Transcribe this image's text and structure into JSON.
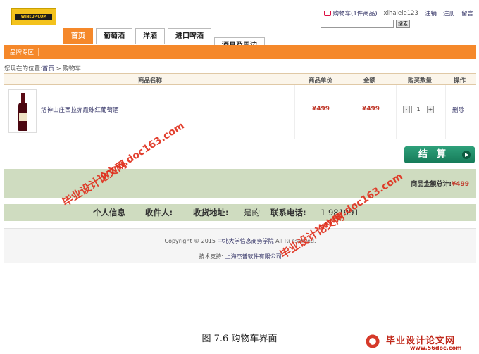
{
  "header": {
    "logo_text": "WINEUP.COM",
    "cart_link": "购物车(1件商品)",
    "username": "xihalele123",
    "logout": "注销",
    "register": "注册",
    "message": "留言",
    "search_button": "搜索"
  },
  "nav": {
    "tabs": [
      "首页",
      "葡萄酒",
      "洋酒",
      "进口啤酒",
      "酒具及周边"
    ]
  },
  "subnav": {
    "brand_zone": "品牌专区"
  },
  "breadcrumb": {
    "prefix": "您现在的位置:",
    "home": "首页",
    "sep": ">",
    "current": "购物车"
  },
  "cart_table": {
    "headers": [
      "商品名称",
      "商品单价",
      "金额",
      "购买数量",
      "操作"
    ],
    "rows": [
      {
        "name": "洛神山庄西拉赤霞珠红葡萄酒",
        "unit_price": "¥499",
        "amount": "¥499",
        "quantity": "1",
        "action": "删除"
      }
    ],
    "minus": "-",
    "plus": "+"
  },
  "checkout": {
    "label": "结　算"
  },
  "total": {
    "label": "商品金额总计:",
    "value": "¥499"
  },
  "info": {
    "personal": "个人信息",
    "recipient_label": "收件人:",
    "address_label": "收货地址:",
    "address_value": "是的",
    "phone_label": "联系电话:",
    "phone_value": "1 981991"
  },
  "footer": {
    "copyright_prefix": "Copyright © 2015",
    "school": "中北大学信息商务学院",
    "rights": "All Ri  eserved.",
    "support_prefix": "技术支持:",
    "support_company": "上海杰普软件有限公司"
  },
  "caption": "图 7.6  购物车界面",
  "watermarks": {
    "cn": "毕业设计论文网",
    "url": "www.doc163.com",
    "brand_cn": "毕业设计论文网",
    "brand_url": "www.56doc.com"
  },
  "colors": {
    "accent_orange": "#f5882a",
    "checkout_green": "#1f8c66",
    "panel_green": "#cfdcc0",
    "price_red": "#c0392b",
    "watermark_red": "#e0301e"
  }
}
